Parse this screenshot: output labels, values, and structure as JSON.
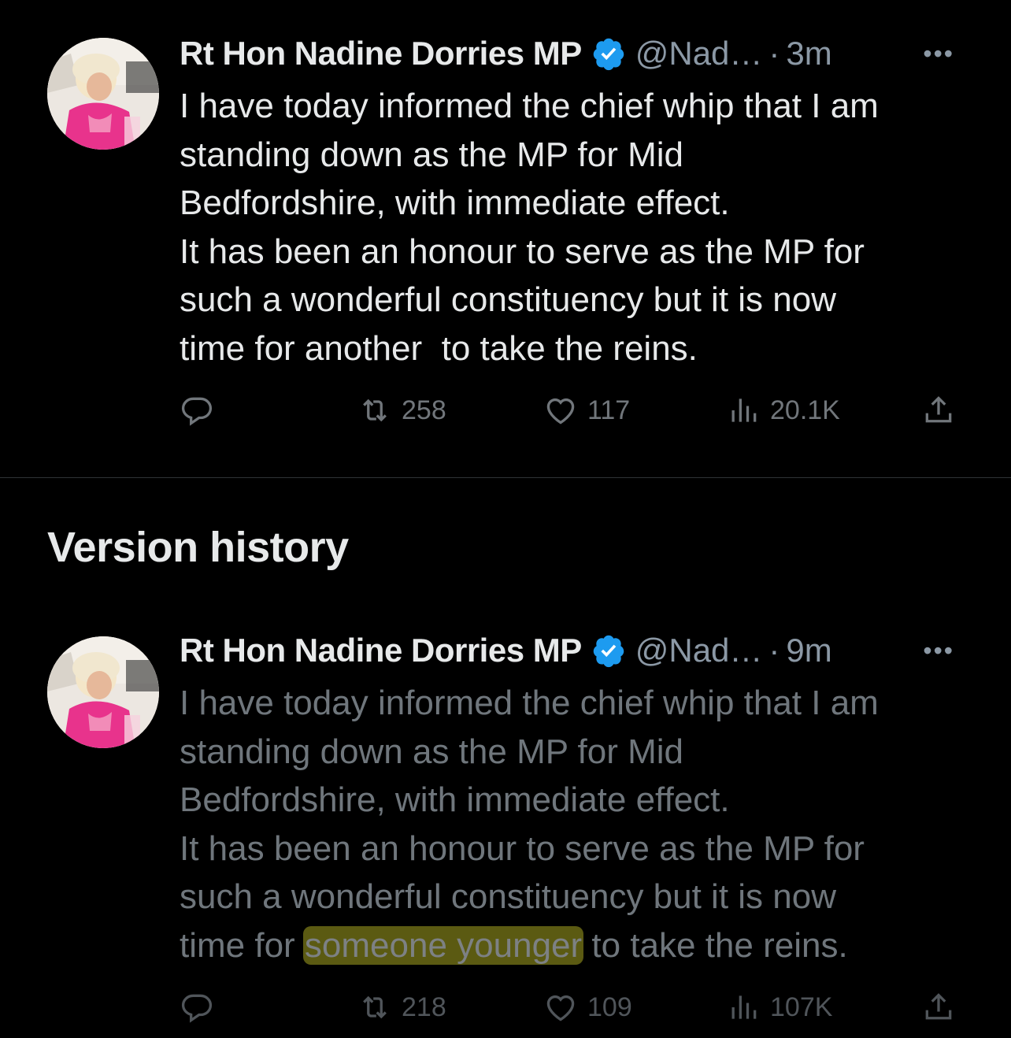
{
  "current_tweet": {
    "author_name": "Rt Hon Nadine Dorries MP",
    "handle": "@Nad…",
    "separator": "·",
    "time": "3m",
    "more": "•••",
    "text": "I have today informed the chief whip that I am\nstanding down as the MP for Mid\nBedfordshire, with immediate effect.\nIt has been an honour to serve as the MP for\nsuch a wonderful constituency but it is now\ntime for another  to take the reins.",
    "retweets": "258",
    "likes": "117",
    "views": "20.1K"
  },
  "section": {
    "title": "Version history"
  },
  "previous_version": {
    "author_name": "Rt Hon Nadine Dorries MP",
    "handle": "@Nad…",
    "separator": "·",
    "time": "9m",
    "more": "•••",
    "text_before": "I have today informed the chief whip that I am\nstanding down as the MP for Mid\nBedfordshire, with immediate effect.\nIt has been an honour to serve as the MP for\nsuch a wonderful constituency but it is now\ntime for ",
    "text_highlight": "someone younger",
    "text_after": " to take the reins.",
    "retweets": "218",
    "likes": "109",
    "views": "107K"
  },
  "colors": {
    "background": "#000000",
    "text": "#e7e9ea",
    "muted": "#71767b",
    "verified": "#1d9bf0",
    "highlight": "#5b5a12"
  },
  "icons": [
    "reply-icon",
    "retweet-icon",
    "like-icon",
    "views-icon",
    "share-icon",
    "verified-badge-icon",
    "more-icon"
  ]
}
